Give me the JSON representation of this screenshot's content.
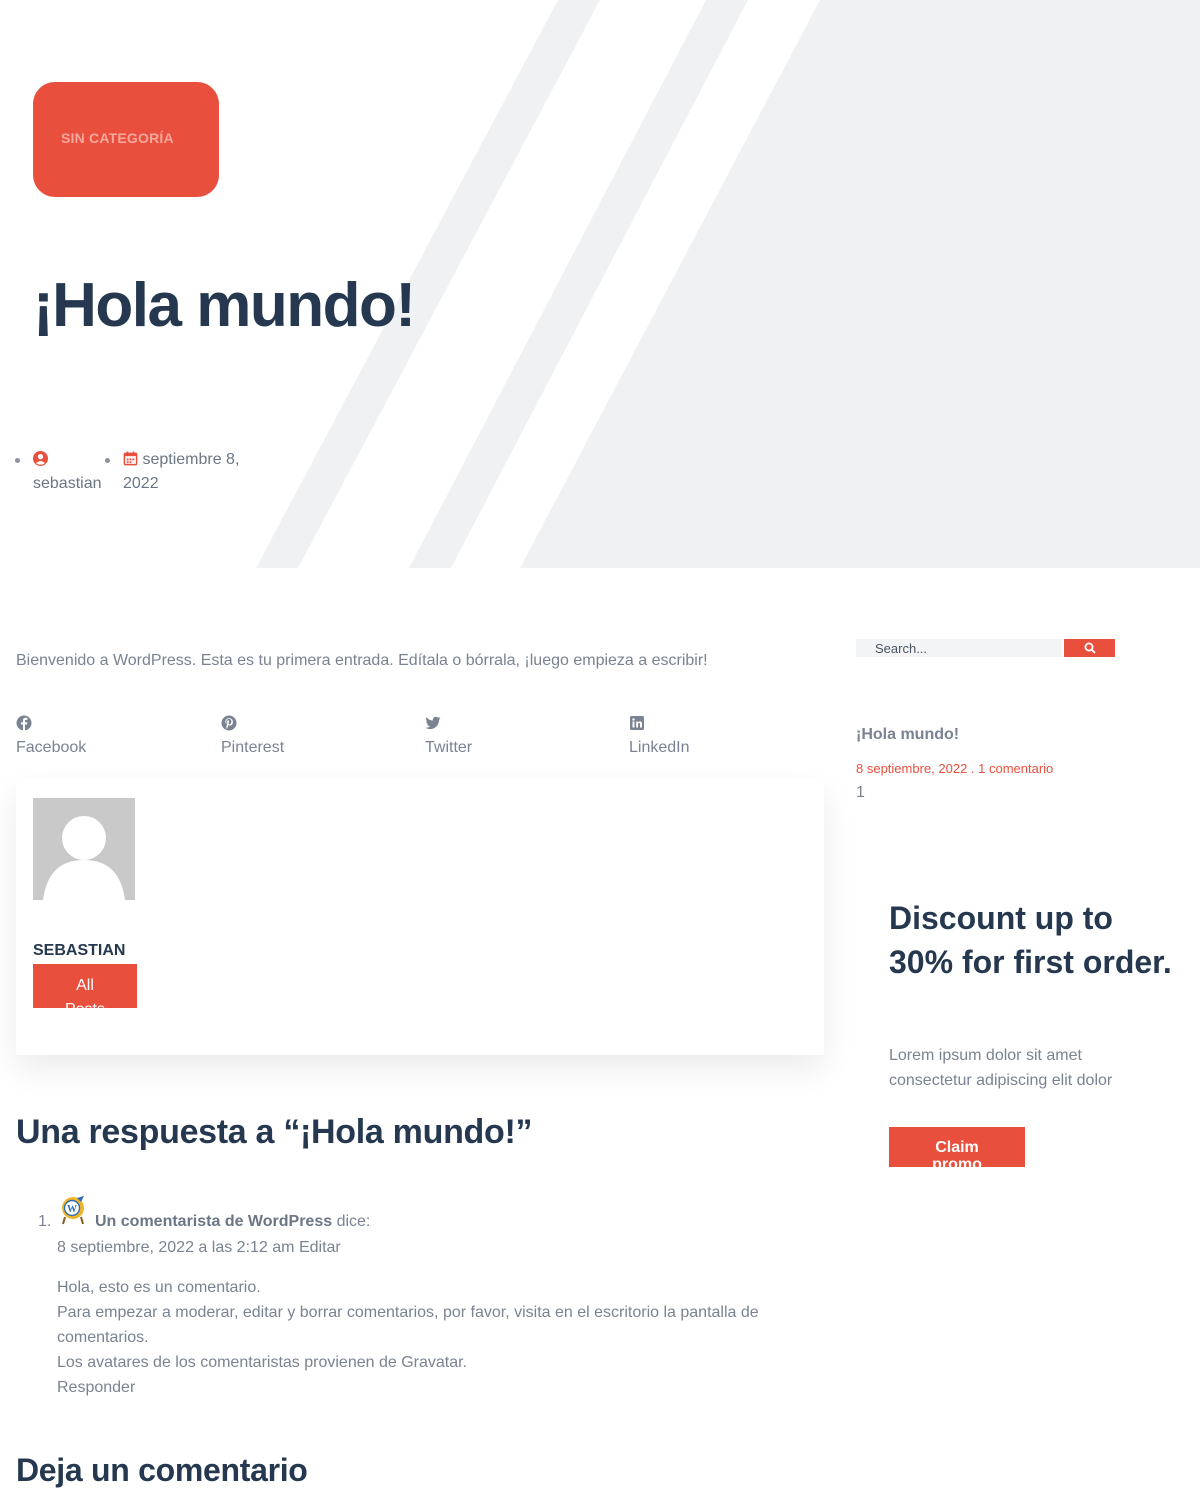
{
  "hero": {
    "category": "SIN CATEGORÍA",
    "title": "¡Hola mundo!",
    "author": "sebastian",
    "date": "septiembre 8, 2022"
  },
  "post": {
    "intro": "Bienvenido a WordPress. Esta es tu primera entrada. Edítala o bórrala, ¡luego empieza a escribir!",
    "share": [
      {
        "label": "Facebook",
        "icon": "facebook-icon"
      },
      {
        "label": "Pinterest",
        "icon": "pinterest-icon"
      },
      {
        "label": "Twitter",
        "icon": "twitter-icon"
      },
      {
        "label": "LinkedIn",
        "icon": "linkedin-icon"
      }
    ],
    "author_box": {
      "name": "SEBASTIAN",
      "button": "All Posts"
    }
  },
  "comments": {
    "title": "Una respuesta a “¡Hola mundo!”",
    "items": [
      {
        "number": "1.",
        "author": "Un comentarista de WordPress",
        "says": "dice:",
        "date": "8 septiembre, 2022 a las 2:12 am",
        "edit": "Editar",
        "lines": [
          "Hola, esto es un comentario.",
          "Para empezar a moderar, editar y borrar comentarios, por favor, visita en el escritorio la pantalla de comentarios.",
          "Los avatares de los comentaristas provienen de Gravatar."
        ],
        "reply": "Responder"
      }
    ],
    "leave_title": "Deja un comentario"
  },
  "sidebar": {
    "search_placeholder": "Search...",
    "recent_post": {
      "title": "¡Hola mundo!",
      "meta": "8 septiembre, 2022 . 1 comentario",
      "count": "1"
    },
    "promo": {
      "title": "Discount up to 30% for first order.",
      "text": "Lorem ipsum dolor sit amet consectetur adipiscing elit dolor",
      "button": "Claim promo"
    }
  },
  "colors": {
    "accent": "#e94f3d",
    "heading": "#25384f",
    "text": "#7a8391",
    "hero_bg": "#f0f1f3"
  }
}
